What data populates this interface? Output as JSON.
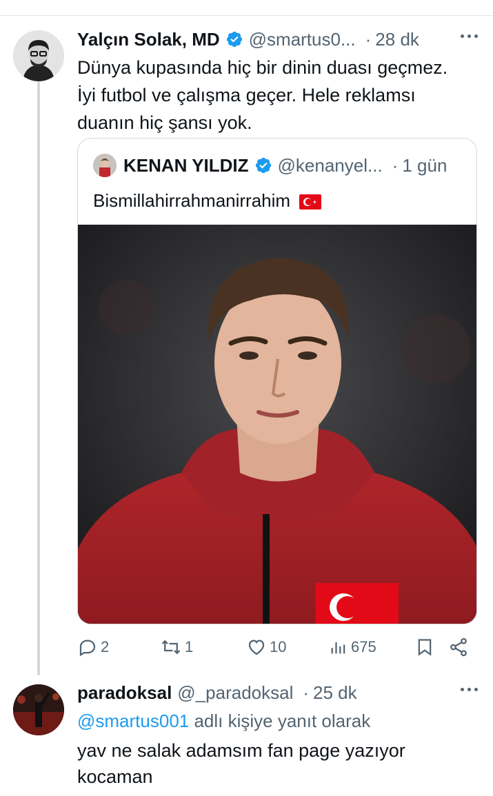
{
  "tweet1": {
    "name": "Yalçın Solak, MD",
    "handle": "@smartus0...",
    "time": "28 dk",
    "lines": [
      "Dünya kupasında hiç bir dinin duası geçmez.",
      "İyi futbol ve çalışma geçer. Hele reklamsı",
      "duanın hiç şansı yok."
    ],
    "quote": {
      "name": "KENAN YILDIZ",
      "handle": "@kenanyel...",
      "time": "1 gün",
      "text": "Bismillahirrahmanirrahim"
    },
    "actions": {
      "replies": "2",
      "retweets": "1",
      "likes": "10",
      "views": "675"
    }
  },
  "tweet2": {
    "name": "paradoksal",
    "handle": "@_paradoksal",
    "time": "25 dk",
    "reply_mention": "@smartus001",
    "reply_suffix": " adlı kişiye yanıt olarak",
    "lines": [
      "yav ne salak adamsım fan page yazıyor",
      "kocaman"
    ]
  },
  "colors": {
    "verified": "#1d9bf0",
    "secondary_text": "#536471",
    "link": "#1d9bf0"
  },
  "icons": [
    "verified-badge-icon",
    "more-icon",
    "reply-icon",
    "retweet-icon",
    "like-icon",
    "views-icon",
    "bookmark-icon",
    "share-icon",
    "turkish-flag-icon"
  ]
}
